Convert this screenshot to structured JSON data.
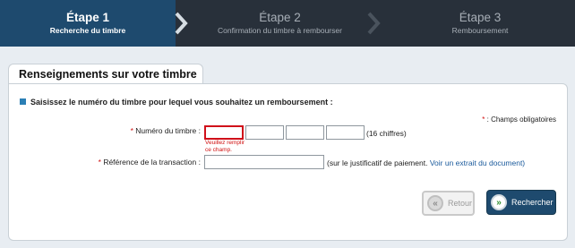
{
  "steps": [
    {
      "num": "Étape 1",
      "desc": "Recherche du timbre",
      "state": "active"
    },
    {
      "num": "Étape 2",
      "desc": "Confirmation du timbre à rembourser",
      "state": "inactive"
    },
    {
      "num": "Étape 3",
      "desc": "Remboursement",
      "state": "inactive"
    }
  ],
  "panel": {
    "title": "Renseignements sur votre timbre",
    "intro": "Saisissez le numéro du timbre pour lequel vous souhaitez un remboursement :",
    "required_star": "*",
    "required_note": " : Champs obligatoires"
  },
  "form": {
    "stamp_label": "Numéro du timbre :",
    "stamp_star": "* ",
    "stamp_values": [
      "",
      "",
      "",
      ""
    ],
    "stamp_hint": "(16 chiffres)",
    "stamp_error": "Veuillez remplir ce champ.",
    "ref_label": "Référence de la transaction :",
    "ref_star": "* ",
    "ref_value": "",
    "ref_hint": "(sur le justificatif de paiement.",
    "ref_link": "Voir un extrait du document)"
  },
  "buttons": {
    "back_label": "Retour",
    "search_label": "Rechercher"
  },
  "colors": {
    "active_step": "#1e4a6e",
    "steps_bg": "#28303a",
    "error": "#d0101a",
    "link": "#1a5a9c"
  }
}
